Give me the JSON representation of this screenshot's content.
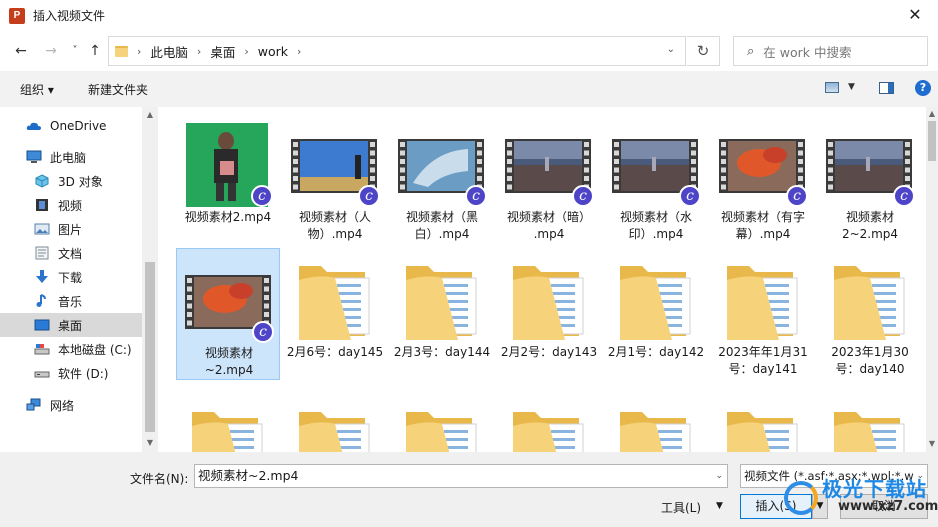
{
  "window": {
    "title": "插入视频文件",
    "app_icon": "P"
  },
  "nav": {
    "back_icon": "←",
    "forward_icon": "→",
    "recent_icon": "˅",
    "up_icon": "↑"
  },
  "address": {
    "crumbs": [
      "此电脑",
      "桌面",
      "work"
    ],
    "sep": "›",
    "dropdown": "⌄",
    "refresh": "↻"
  },
  "search": {
    "placeholder": "在 work 中搜索",
    "icon": "⌕"
  },
  "toolbar": {
    "organize": "组织 ▾",
    "new_folder": "新建文件夹",
    "help": "?"
  },
  "sidebar": {
    "items": [
      {
        "label": "OneDrive",
        "icon": "cloud-icon"
      },
      {
        "label": "此电脑",
        "icon": "computer-icon"
      },
      {
        "label": "3D 对象",
        "icon": "cube-icon"
      },
      {
        "label": "视频",
        "icon": "video-icon"
      },
      {
        "label": "图片",
        "icon": "picture-icon"
      },
      {
        "label": "文档",
        "icon": "document-icon"
      },
      {
        "label": "下载",
        "icon": "download-icon"
      },
      {
        "label": "音乐",
        "icon": "music-icon"
      },
      {
        "label": "桌面",
        "icon": "desktop-icon",
        "selected": true
      },
      {
        "label": "本地磁盘 (C:)",
        "icon": "drive-icon"
      },
      {
        "label": "软件 (D:)",
        "icon": "drive-icon"
      },
      {
        "label": "网络",
        "icon": "network-icon"
      }
    ]
  },
  "files": [
    {
      "line1": "视频素材2.mp4",
      "line2": "",
      "kind": "video-green"
    },
    {
      "line1": "视频素材（人",
      "line2": "物）.mp4",
      "kind": "video-sky"
    },
    {
      "line1": "视频素材（黑",
      "line2": "白）.mp4",
      "kind": "video-ice"
    },
    {
      "line1": "视频素材（暗）",
      "line2": ".mp4",
      "kind": "video-city"
    },
    {
      "line1": "视频素材（水",
      "line2": "印）.mp4",
      "kind": "video-city"
    },
    {
      "line1": "视频素材（有字",
      "line2": "幕）.mp4",
      "kind": "video-leaf"
    },
    {
      "line1": "视频素材",
      "line2": "2~2.mp4",
      "kind": "video-city"
    },
    {
      "line1": "视频素材",
      "line2": "~2.mp4",
      "kind": "video-leaf",
      "selected": true
    },
    {
      "line1": "2月6号：day145",
      "line2": "",
      "kind": "folder"
    },
    {
      "line1": "2月3号：day144",
      "line2": "",
      "kind": "folder"
    },
    {
      "line1": "2月2号：day143",
      "line2": "",
      "kind": "folder"
    },
    {
      "line1": "2月1号：day142",
      "line2": "",
      "kind": "folder"
    },
    {
      "line1": "2023年年1月31",
      "line2": "号：day141",
      "kind": "folder"
    },
    {
      "line1": "2023年1月30",
      "line2": "号：day140",
      "kind": "folder"
    },
    {
      "line1": "",
      "line2": "",
      "kind": "folder"
    },
    {
      "line1": "",
      "line2": "",
      "kind": "folder"
    },
    {
      "line1": "",
      "line2": "",
      "kind": "folder"
    },
    {
      "line1": "",
      "line2": "",
      "kind": "folder"
    },
    {
      "line1": "",
      "line2": "",
      "kind": "folder"
    },
    {
      "line1": "",
      "line2": "",
      "kind": "folder"
    },
    {
      "line1": "",
      "line2": "",
      "kind": "folder"
    }
  ],
  "footer": {
    "filename_label": "文件名(N):",
    "filename_value": "视频素材~2.mp4",
    "filter_value": "视频文件 (*.asf;*.asx;*.wpl;*.wm",
    "tools": "工具(L)",
    "insert": "插入(S)",
    "cancel": "取消"
  },
  "watermark": {
    "text": "极光下载站",
    "url": "www.xz7.com"
  },
  "colors": {
    "accent": "#0078d7",
    "selection": "#cde5fb",
    "folder": "#f6d27a",
    "badge": "#4d44c8"
  }
}
